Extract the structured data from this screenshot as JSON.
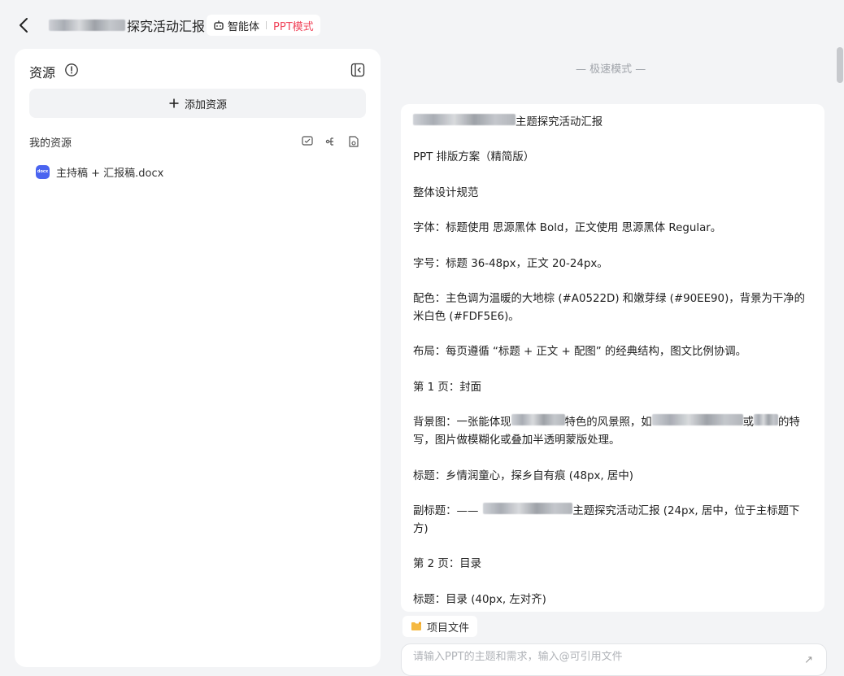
{
  "header": {
    "title_visible": "探究活动汇报",
    "agent_label": "智能体",
    "mode_label": "PPT模式"
  },
  "left_panel": {
    "title": "资源",
    "add_label": "添加资源",
    "my_resources_label": "我的资源",
    "files": [
      {
        "badge": "docx",
        "name": "主持稿 + 汇报稿.docx"
      }
    ]
  },
  "main": {
    "mode_text": "— 极速模式 —",
    "paragraphs": [
      "主题探究活动汇报",
      "PPT 排版方案（精简版）",
      "整体设计规范",
      "字体：标题使用 思源黑体 Bold，正文使用 思源黑体 Regular。",
      "字号：标题 36-48px，正文 20-24px。",
      "配色：主色调为温暖的大地棕 (#A0522D) 和嫩芽绿 (#90EE90)，背景为干净的米白色 (#FDF5E6)。",
      "布局：每页遵循 “标题 + 正文 + 配图” 的经典结构，图文比例协调。",
      "第 1 页：封面",
      "背景图：一张能体现 特色的风景照，如 或 的特写，图片做模糊化或叠加半透明蒙版处理。",
      "标题：乡情润童心，探乡自有痕 (48px, 居中)",
      "副标题：—— 主题探究活动汇报 (24px, 居中，位于主标题下方)",
      "第 2 页：目录",
      "标题：目录 (40px, 左对齐)"
    ],
    "bg_prefix": "背景图：一张能体现",
    "bg_mid1": "特色的风景照，如",
    "bg_mid2": "或",
    "bg_suffix": "的特写，图片做模糊化或叠加半透明蒙版处理。",
    "subtitle_prefix": "副标题：——",
    "subtitle_suffix": "主题探究活动汇报 (24px, 居中，位于主标题下方)",
    "project_files_label": "项目文件",
    "input_placeholder": "请输入PPT的主题和需求，输入@可引用文件"
  },
  "colors": {
    "ppt_mode": "#f0445a",
    "docx_badge": "#4a64f0",
    "folder_icon": "#f5b942"
  }
}
